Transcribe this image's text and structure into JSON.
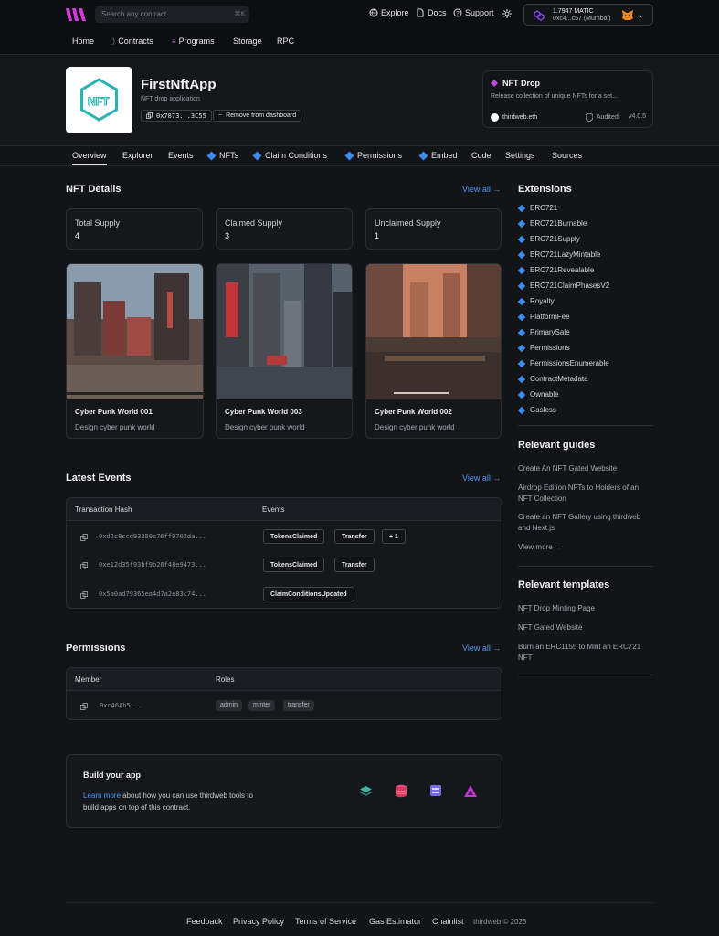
{
  "header": {
    "search_placeholder": "Search any contract",
    "search_shortcut": "⌘K",
    "links": [
      "Explore",
      "Docs",
      "Support"
    ],
    "wallet": {
      "balance": "1.7947 MATIC",
      "address": "0xc4...c57 (Mumbai)"
    }
  },
  "nav": [
    "Home",
    "Contracts",
    "Programs",
    "Storage",
    "RPC"
  ],
  "contract": {
    "name": "FirstNftApp",
    "description": "NFT drop application",
    "address": "0x7873...3C55",
    "remove_label": "Remove from dashboard"
  },
  "drop_card": {
    "title": "NFT Drop",
    "description": "Release collection of unique NFTs for a set...",
    "author": "thirdweb.eth",
    "audited": "Audited",
    "version": "v4.0.5"
  },
  "tabs": [
    "Overview",
    "Explorer",
    "Events",
    "NFTs",
    "Claim Conditions",
    "Permissions",
    "Embed",
    "Code",
    "Settings",
    "Sources"
  ],
  "nft_details": {
    "title": "NFT Details",
    "view_all": "View all →",
    "stats": [
      {
        "label": "Total Supply",
        "value": "4"
      },
      {
        "label": "Claimed Supply",
        "value": "3"
      },
      {
        "label": "Unclaimed Supply",
        "value": "1"
      }
    ],
    "nfts": [
      {
        "name": "Cyber Punk World 001",
        "description": "Design cyber punk world"
      },
      {
        "name": "Cyber Punk World 003",
        "description": "Design cyber punk world"
      },
      {
        "name": "Cyber Punk World 002",
        "description": "Design cyber punk world"
      }
    ]
  },
  "events": {
    "title": "Latest Events",
    "view_all": "View all →",
    "col_hash": "Transaction Hash",
    "col_events": "Events",
    "rows": [
      {
        "hash": "0xd2c8ccd93350c76ff9702da...",
        "tags": [
          "TokensClaimed",
          "Transfer",
          "+ 1"
        ]
      },
      {
        "hash": "0xe12d35f93bf9b26f48e9473...",
        "tags": [
          "TokensClaimed",
          "Transfer"
        ]
      },
      {
        "hash": "0x5a0ad79365ea4d7a2e83c74...",
        "tags": [
          "ClaimConditionsUpdated"
        ]
      }
    ]
  },
  "permissions": {
    "title": "Permissions",
    "view_all": "View all →",
    "col_member": "Member",
    "col_roles": "Roles",
    "member": "0xc46Ab5...",
    "roles": [
      "admin",
      "minter",
      "transfer"
    ]
  },
  "build": {
    "title": "Build your app",
    "link": "Learn more",
    "text1": "about how you can use thirdweb tools to",
    "text2": "build apps on top of this contract."
  },
  "extensions": {
    "title": "Extensions",
    "items": [
      "ERC721",
      "ERC721Burnable",
      "ERC721Supply",
      "ERC721LazyMintable",
      "ERC721Revealable",
      "ERC721ClaimPhasesV2",
      "Royalty",
      "PlatformFee",
      "PrimarySale",
      "Permissions",
      "PermissionsEnumerable",
      "ContractMetadata",
      "Ownable",
      "Gasless"
    ]
  },
  "guides": {
    "title": "Relevant guides",
    "items": [
      "Create An NFT Gated Website",
      "Airdrop Edition NFTs to Holders of an NFT Collection",
      "Create an NFT Gallery using thirdweb and Next.js"
    ],
    "view_more": "View more →"
  },
  "templates": {
    "title": "Relevant templates",
    "items": [
      "NFT Drop Minting Page",
      "NFT Gated Website",
      "Burn an ERC1155 to Mint an ERC721 NFT"
    ]
  },
  "footer": [
    "Feedback",
    "Privacy Policy",
    "Terms of Service",
    "Gas Estimator",
    "Chainlist"
  ],
  "copyright": "thirdweb © 2023",
  "colors": {
    "accent": "#4d9bf5",
    "background": "#131417",
    "diamond": "#3b8cf0"
  }
}
